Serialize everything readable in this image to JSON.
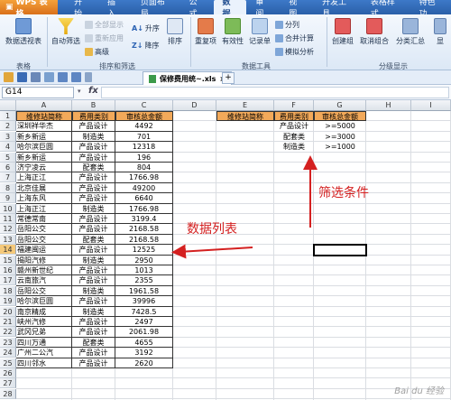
{
  "menubar": {
    "app_label": "WPS 表格",
    "items": [
      "开始",
      "插入",
      "页面布局",
      "公式",
      "数据",
      "审阅",
      "视图",
      "开发工具",
      "表格样式",
      "特色功"
    ],
    "active_index": 4
  },
  "ribbon": {
    "pivot": "数据透视表",
    "autofilter": "自动筛选",
    "show_all": "全部显示",
    "reapply": "重新应用",
    "advanced": "高级",
    "sort_asc": "升序",
    "sort_desc": "降序",
    "sort": "排序",
    "duplicates": "重复项",
    "validity": "有效性",
    "record": "记录单",
    "split": "分列",
    "merge_calc": "合并计算",
    "simulate": "模拟分析",
    "group_create": "创建组",
    "group_cancel": "取消组合",
    "subtotal": "分类汇总",
    "more": "显",
    "groups": {
      "table": "表格",
      "sort_filter": "排序和筛选",
      "data_tools": "数据工具",
      "outline": "分级显示"
    }
  },
  "tab": {
    "name": "保修费用统~.xls",
    "close": "×",
    "add": "+"
  },
  "formula": {
    "cell_ref": "G14",
    "fx": "fx"
  },
  "columns": [
    "A",
    "B",
    "C",
    "D",
    "E",
    "F",
    "G",
    "H",
    "I"
  ],
  "rows": [
    "1",
    "2",
    "3",
    "4",
    "5",
    "6",
    "7",
    "8",
    "9",
    "10",
    "11",
    "12",
    "13",
    "14",
    "15",
    "16",
    "17",
    "18",
    "19",
    "20",
    "21",
    "22",
    "23",
    "24",
    "25",
    "26",
    "27",
    "28"
  ],
  "data_table": {
    "headers": [
      "维修站简称",
      "费用类别",
      "审核总金额"
    ],
    "rows": [
      [
        "深圳祥华杰",
        "产品设计",
        "4492"
      ],
      [
        "新乡新运",
        "制造类",
        "701"
      ],
      [
        "哈尔滨巨圆",
        "产品设计",
        "12318"
      ],
      [
        "新乡新运",
        "产品设计",
        "196"
      ],
      [
        "济宁凌云",
        "配套类",
        "804"
      ],
      [
        "上海正江",
        "产品设计",
        "1766.98"
      ],
      [
        "北京佳展",
        "产品设计",
        "49200"
      ],
      [
        "上海东风",
        "产品设计",
        "6640"
      ],
      [
        "上海正江",
        "制造类",
        "1766.98"
      ],
      [
        "常德常南",
        "产品设计",
        "3199.4"
      ],
      [
        "岳阳公交",
        "产品设计",
        "2168.58"
      ],
      [
        "岳阳公交",
        "配套类",
        "2168.58"
      ],
      [
        "福建闽运",
        "产品设计",
        "12525"
      ],
      [
        "揭阳汽修",
        "制造类",
        "2950"
      ],
      [
        "赣州新世纪",
        "产品设计",
        "1013"
      ],
      [
        "云南旅汽",
        "产品设计",
        "2355"
      ],
      [
        "岳阳公交",
        "制造类",
        "1961.58"
      ],
      [
        "哈尔滨巨圆",
        "产品设计",
        "39996"
      ],
      [
        "南京精成",
        "制造类",
        "7428.5"
      ],
      [
        "峡州汽修",
        "产品设计",
        "2497"
      ],
      [
        "武冈兄弟",
        "产品设计",
        "2061.98"
      ],
      [
        "四川万通",
        "配套类",
        "4655"
      ],
      [
        "广州二公汽",
        "产品设计",
        "3192"
      ],
      [
        "四川邻水",
        "产品设计",
        "2620"
      ]
    ]
  },
  "criteria_table": {
    "headers": [
      "维修站简称",
      "费用类别",
      "审核总金额"
    ],
    "rows": [
      [
        "",
        "产品设计",
        ">=5000"
      ],
      [
        "",
        "配套类",
        ">=3000"
      ],
      [
        "",
        "制造类",
        ">=1000"
      ]
    ]
  },
  "annotations": {
    "criteria_label": "筛选条件",
    "data_label": "数据列表",
    "color": "#d42020"
  },
  "watermark": "Bai du 经验"
}
